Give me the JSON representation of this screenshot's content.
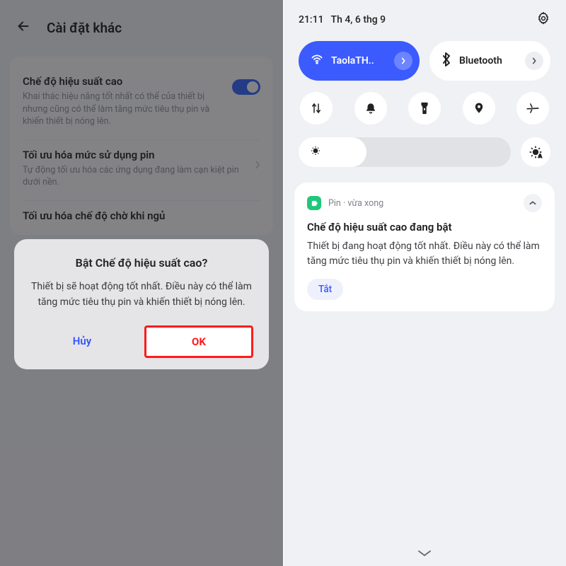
{
  "left": {
    "header_title": "Cài đặt khác",
    "settings": [
      {
        "title": "Chế độ hiệu suất cao",
        "sub": "Khai thác hiệu năng tốt nhất có thể của thiết bị nhưng cũng có thể làm tăng mức tiêu thụ pin và khiến thiết bị nóng lên."
      },
      {
        "title": "Tối ưu hóa mức sử dụng pin",
        "sub": "Tự động tối ưu hóa các ứng dụng đang làm cạn kiệt pin dưới nền."
      },
      {
        "title": "Tối ưu hóa chế độ chờ khi ngủ",
        "sub": ""
      }
    ],
    "dialog": {
      "title": "Bật Chế độ hiệu suất cao?",
      "body": "Thiết bị sẽ hoạt động tốt nhất. Điều này có thể làm tăng mức tiêu thụ pin và khiến thiết bị nóng lên.",
      "cancel": "Hủy",
      "ok": "OK"
    }
  },
  "right": {
    "status_time": "21:11",
    "status_date": "Th 4, 6 thg 9",
    "wifi_label": "TaolaTH..",
    "bt_label": "Bluetooth",
    "notification": {
      "app": "Pin",
      "time_sep": " · ",
      "time": "vừa xong",
      "title": "Chế độ hiệu suất cao đang bật",
      "body": "Thiết bị đang hoạt động tốt nhất. Điều này có thể làm tăng mức tiêu thụ pin và khiến thiết bị nóng lên.",
      "action": "Tắt"
    }
  }
}
